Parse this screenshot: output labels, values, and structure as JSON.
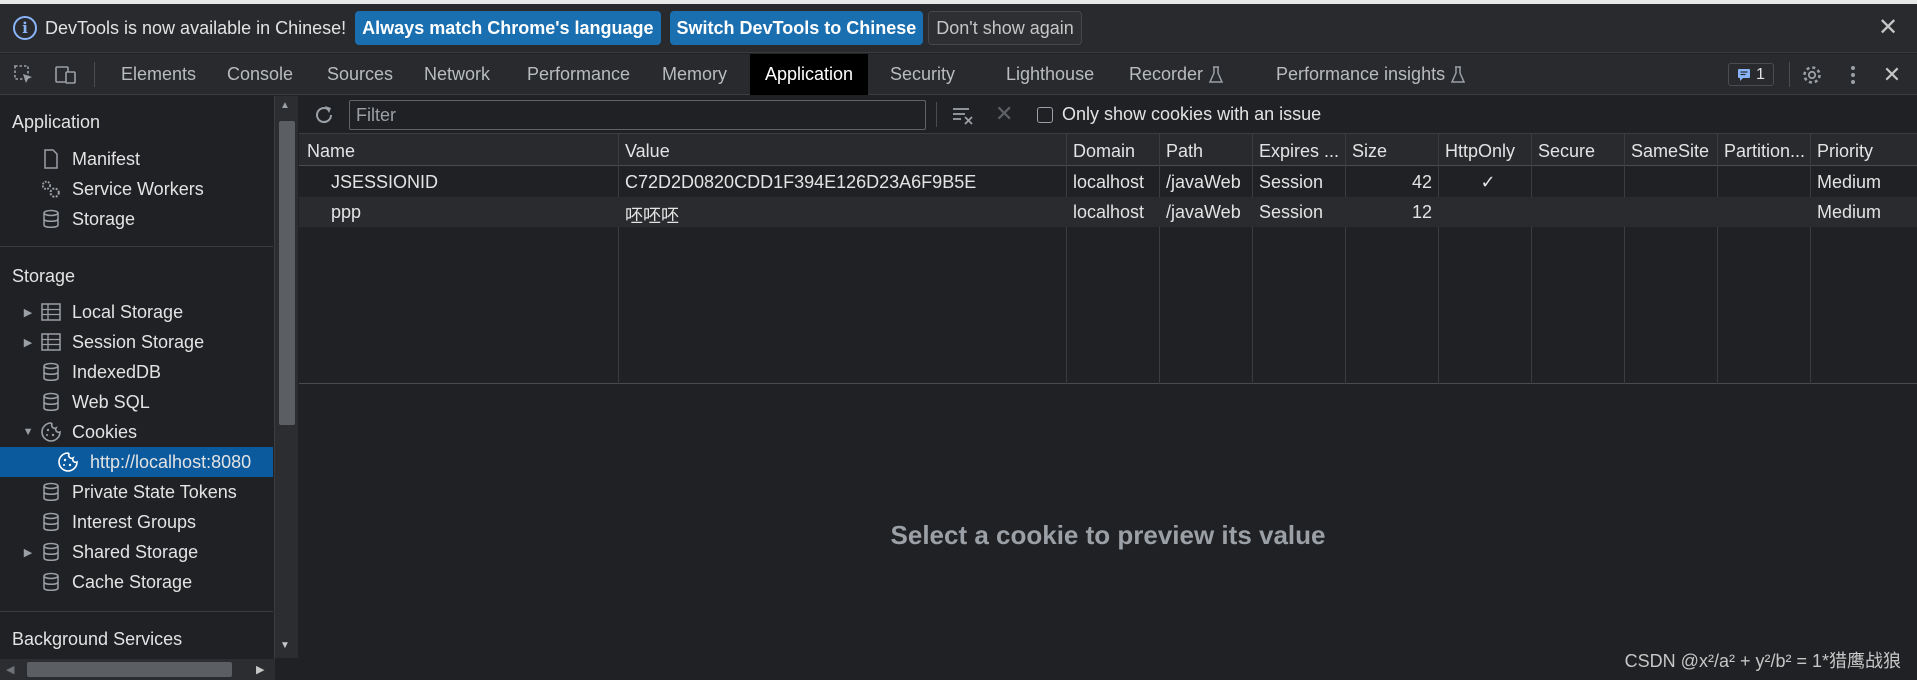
{
  "infobar": {
    "message": "DevTools is now available in Chinese!",
    "btn_match": "Always match Chrome's language",
    "btn_switch": "Switch DevTools to Chinese",
    "btn_dismiss": "Don't show again"
  },
  "tabs": {
    "elements": "Elements",
    "console": "Console",
    "sources": "Sources",
    "network": "Network",
    "performance": "Performance",
    "memory": "Memory",
    "application": "Application",
    "security": "Security",
    "lighthouse": "Lighthouse",
    "recorder": "Recorder",
    "perf_insights": "Performance insights",
    "issues_count": "1"
  },
  "sidebar": {
    "application_header": "Application",
    "manifest": "Manifest",
    "service_workers": "Service Workers",
    "storage": "Storage",
    "storage_header": "Storage",
    "local_storage": "Local Storage",
    "session_storage": "Session Storage",
    "indexeddb": "IndexedDB",
    "web_sql": "Web SQL",
    "cookies": "Cookies",
    "cookie_origin": "http://localhost:8080",
    "private_state_tokens": "Private State Tokens",
    "interest_groups": "Interest Groups",
    "shared_storage": "Shared Storage",
    "cache_storage": "Cache Storage",
    "background_header": "Background Services"
  },
  "toolbar": {
    "filter_placeholder": "Filter",
    "only_issues_label": "Only show cookies with an issue"
  },
  "table": {
    "headers": {
      "name": "Name",
      "value": "Value",
      "domain": "Domain",
      "path": "Path",
      "expires": "Expires ...",
      "size": "Size",
      "httponly": "HttpOnly",
      "secure": "Secure",
      "samesite": "SameSite",
      "partition": "Partition...",
      "priority": "Priority"
    },
    "rows": [
      {
        "name": "JSESSIONID",
        "value": "C72D2D0820CDD1F394E126D23A6F9B5E",
        "domain": "localhost",
        "path": "/javaWeb",
        "expires": "Session",
        "size": "42",
        "httponly": "✓",
        "priority": "Medium"
      },
      {
        "name": "ppp",
        "value": "呸呸呸",
        "domain": "localhost",
        "path": "/javaWeb",
        "expires": "Session",
        "size": "12",
        "httponly": "",
        "priority": "Medium"
      }
    ]
  },
  "preview_message": "Select a cookie to preview its value",
  "watermark": "CSDN @x²/a² + y²/b² = 1*猎鹰战狼",
  "colors": {
    "accent": "#1a6fb0",
    "selected": "#0c5a9e",
    "background": "#202124"
  }
}
